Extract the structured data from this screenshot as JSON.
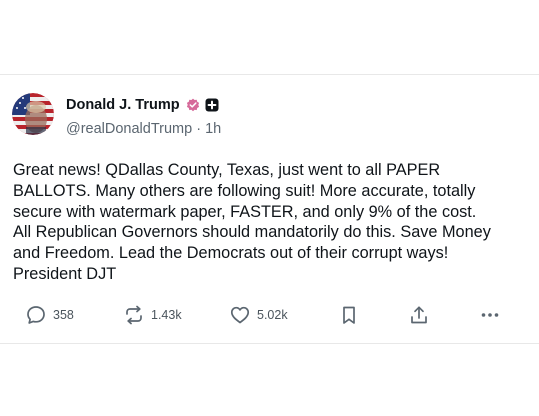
{
  "post": {
    "author": {
      "display_name": "Donald J. Trump",
      "handle": "@realDonaldTrump",
      "separator": "·",
      "time": "1h",
      "verified_badge_color": "#d66a9a"
    },
    "body": "Great news! QDallas County, Texas, just went to all PAPER\nBALLOTS. Many others are following suit! More accurate, totally\nsecure with watermark paper, FASTER, and only 9% of the cost.\nAll Republican Governors should mandatorily do this. Save Money\nand Freedom. Lead the Democrats out of their corrupt ways!\nPresident DJT",
    "actions": {
      "replies": "358",
      "reposts": "1.43k",
      "likes": "5.02k",
      "icons": [
        "comment-icon",
        "repost-icon",
        "heart-icon",
        "bookmark-icon",
        "share-icon",
        "more-icon"
      ]
    }
  }
}
